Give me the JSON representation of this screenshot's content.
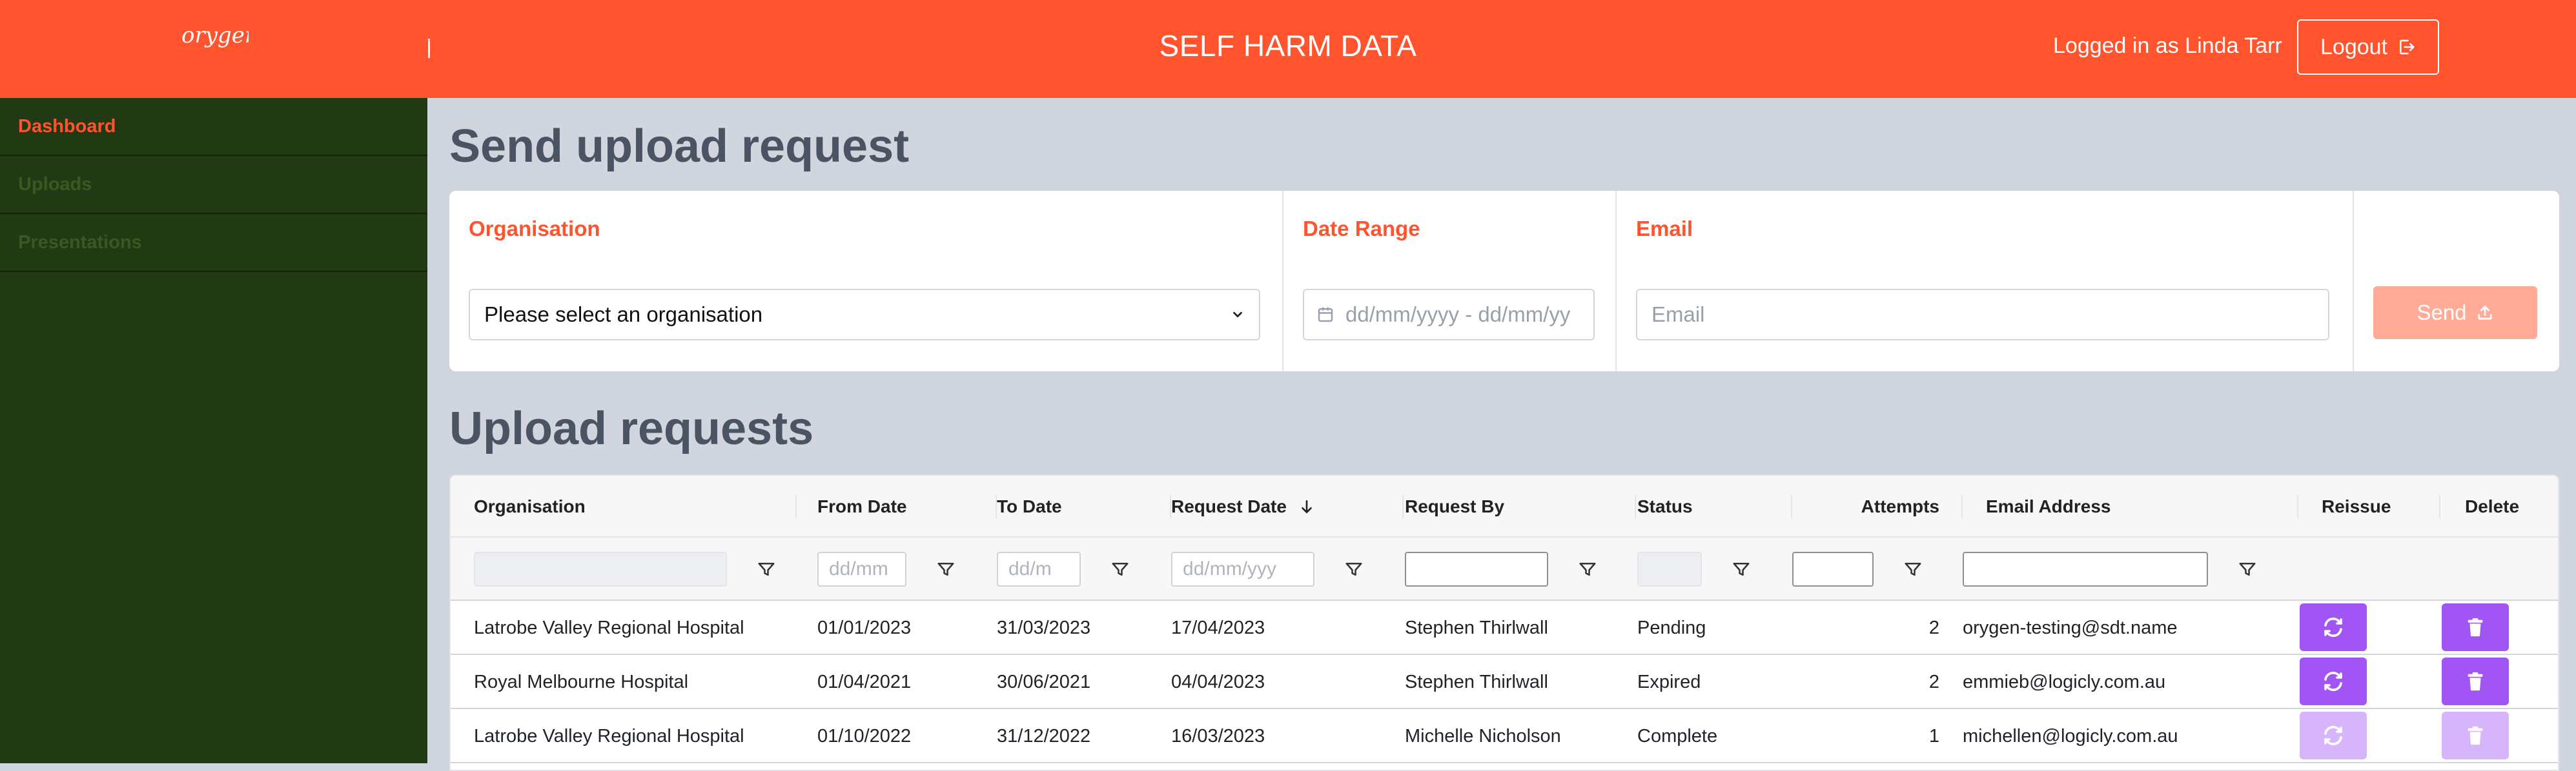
{
  "header": {
    "logo_text": "orygen",
    "title": "SELF HARM DATA",
    "logged_in_text": "Logged in as Linda Tarr",
    "logout_label": "Logout"
  },
  "sidebar": {
    "items": [
      {
        "label": "Dashboard",
        "active": true
      },
      {
        "label": "Uploads",
        "active": false
      },
      {
        "label": "Presentations",
        "active": false
      }
    ]
  },
  "send_request": {
    "title": "Send upload request",
    "organisation_label": "Organisation",
    "organisation_value": "Please select an organisation",
    "date_range_label": "Date Range",
    "date_range_placeholder": "dd/mm/yyyy - dd/mm/yy",
    "email_label": "Email",
    "email_placeholder": "Email",
    "send_label": "Send"
  },
  "upload_requests": {
    "title": "Upload requests",
    "columns": [
      "Organisation",
      "From Date",
      "To Date",
      "Request Date",
      "Request By",
      "Status",
      "Attempts",
      "Email Address",
      "Reissue",
      "Delete"
    ],
    "filters": {
      "from_date_placeholder": "dd/mm",
      "to_date_placeholder": "dd/m",
      "request_date_placeholder": "dd/mm/yyy"
    },
    "rows": [
      {
        "organisation": "Latrobe Valley Regional Hospital",
        "from": "01/01/2023",
        "to": "31/03/2023",
        "requested": "17/04/2023",
        "by": "Stephen Thirlwall",
        "status": "Pending",
        "attempts": "2",
        "email": "orygen-testing@sdt.name",
        "enabled": true
      },
      {
        "organisation": "Royal Melbourne Hospital",
        "from": "01/04/2021",
        "to": "30/06/2021",
        "requested": "04/04/2023",
        "by": "Stephen Thirlwall",
        "status": "Expired",
        "attempts": "2",
        "email": "emmieb@logicly.com.au",
        "enabled": true
      },
      {
        "organisation": "Latrobe Valley Regional Hospital",
        "from": "01/10/2022",
        "to": "31/12/2022",
        "requested": "16/03/2023",
        "by": "Michelle Nicholson",
        "status": "Complete",
        "attempts": "1",
        "email": "michellen@logicly.com.au",
        "enabled": false
      }
    ]
  },
  "colors": {
    "accent": "#ff542e",
    "sidebar": "#213a13",
    "action_purple": "#a155f5",
    "action_purple_disabled": "#d6b5fb",
    "send_disabled": "#ffab98"
  }
}
